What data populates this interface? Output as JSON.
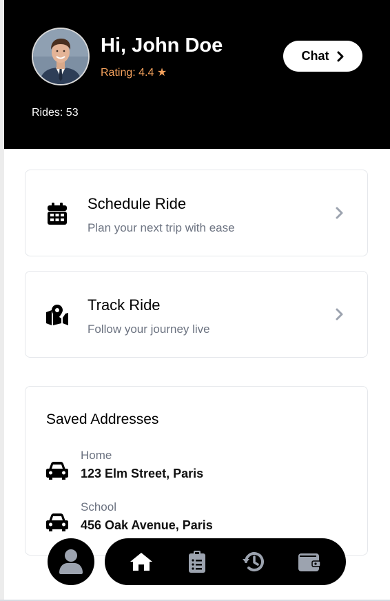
{
  "colors": {
    "header_bg": "#000000",
    "accent_rating": "#f5a25d",
    "muted_text": "#6b7280",
    "icon_gray": "#9ca3af",
    "card_border": "#e5e7eb"
  },
  "header": {
    "greeting": "Hi, John Doe",
    "rating": "Rating: 4.4 ★",
    "rides": "Rides: 53",
    "chat_label": "Chat",
    "avatar_icon": "user-photo",
    "chat_icon": "chevron-right-icon"
  },
  "actions": [
    {
      "title": "Schedule Ride",
      "subtitle": "Plan your next trip with ease",
      "icon": "calendar-icon"
    },
    {
      "title": "Track Ride",
      "subtitle": "Follow your journey live",
      "icon": "map-pin-icon"
    }
  ],
  "saved_addresses": {
    "title": "Saved Addresses",
    "items": [
      {
        "label": "Home",
        "address": "123 Elm Street, Paris",
        "icon": "car-icon"
      },
      {
        "label": "School",
        "address": "456 Oak Avenue, Paris",
        "icon": "car-icon"
      }
    ]
  },
  "bottom_nav": {
    "profile_icon": "user-icon",
    "items": [
      {
        "icon": "home-icon"
      },
      {
        "icon": "clipboard-list-icon"
      },
      {
        "icon": "history-icon"
      },
      {
        "icon": "wallet-icon"
      }
    ]
  }
}
